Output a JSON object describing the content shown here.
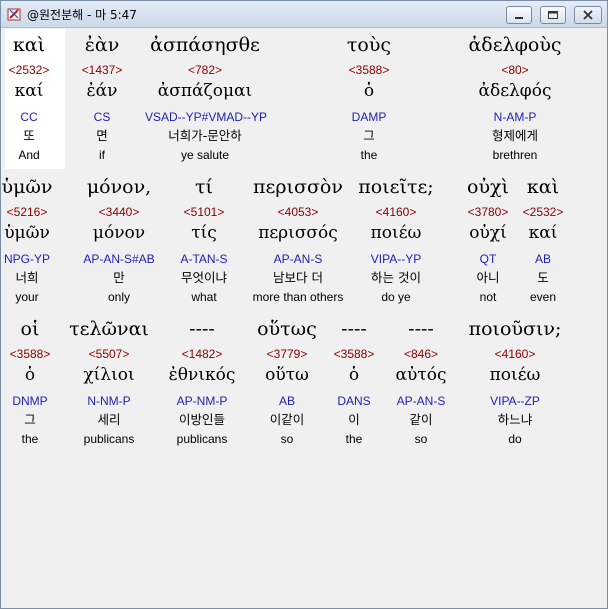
{
  "window": {
    "title": "@원전분해 - 마 5:47",
    "icon": "bible-app-icon",
    "controls": [
      "minimize",
      "maximize",
      "close"
    ]
  },
  "rows": [
    {
      "words": [
        {
          "greek": "καὶ",
          "strong": "<2532>",
          "lemma": "καί",
          "parse": "CC",
          "korean": "또",
          "english": "And"
        },
        {
          "greek": "ἐὰν",
          "strong": "<1437>",
          "lemma": "ἐάν",
          "parse": "CS",
          "korean": "면",
          "english": "if"
        },
        {
          "greek": "ἀσπάσησθε",
          "strong": "<782>",
          "lemma": "ἀσπάζομαι",
          "parse": "VSAD--YP#VMAD--YP",
          "korean": "너희가-문안하",
          "english": "ye salute"
        },
        {
          "greek": "τοὺς",
          "strong": "<3588>",
          "lemma": "ὁ",
          "parse": "DAMP",
          "korean": "그",
          "english": "the"
        },
        {
          "greek": "ἀδελφοὺς",
          "strong": "<80>",
          "lemma": "ἀδελφός",
          "parse": "N-AM-P",
          "korean": "형제에게",
          "english": "brethren"
        }
      ]
    },
    {
      "words": [
        {
          "greek": "ὑμῶν",
          "strong": "<5216>",
          "lemma": "ὑμῶν",
          "parse": "NPG-YP",
          "korean": "너희",
          "english": "your"
        },
        {
          "greek": "μόνον,",
          "strong": "<3440>",
          "lemma": "μόνον",
          "parse": "AP-AN-S#AB",
          "korean": "만",
          "english": "only"
        },
        {
          "greek": "τί",
          "strong": "<5101>",
          "lemma": "τίς",
          "parse": "A-TAN-S",
          "korean": "무엇이냐",
          "english": "what"
        },
        {
          "greek": "περισσὸν",
          "strong": "<4053>",
          "lemma": "περισσός",
          "parse": "AP-AN-S",
          "korean": "남보다 더",
          "english": "more than others"
        },
        {
          "greek": "ποιεῖτε;",
          "strong": "<4160>",
          "lemma": "ποιέω",
          "parse": "VIPA--YP",
          "korean": "하는 것이",
          "english": "do ye"
        },
        {
          "greek": "οὐχὶ",
          "strong": "<3780>",
          "lemma": "οὐχί",
          "parse": "QT",
          "korean": "아니",
          "english": "not"
        },
        {
          "greek": "καὶ",
          "strong": "<2532>",
          "lemma": "καί",
          "parse": "AB",
          "korean": "도",
          "english": "even"
        }
      ]
    },
    {
      "words": [
        {
          "greek": "οἱ",
          "strong": "<3588>",
          "lemma": "ὁ",
          "parse": "DNMP",
          "korean": "그",
          "english": "the"
        },
        {
          "greek": "τελῶναι",
          "strong": "<5507>",
          "lemma": "χίλιοι",
          "parse": "N-NM-P",
          "korean": "세리",
          "english": "publicans"
        },
        {
          "greek": "----",
          "strong": "<1482>",
          "lemma": "ἐθνικός",
          "parse": "AP-NM-P",
          "korean": "이방인들",
          "english": "publicans"
        },
        {
          "greek": "οὕτως",
          "strong": "<3779>",
          "lemma": "οὕτω",
          "parse": "AB",
          "korean": "이같이",
          "english": "so"
        },
        {
          "greek": "----",
          "strong": "<3588>",
          "lemma": "ὁ",
          "parse": "DANS",
          "korean": "이",
          "english": "the"
        },
        {
          "greek": "----",
          "strong": "<846>",
          "lemma": "αὐτός",
          "parse": "AP-AN-S",
          "korean": "같이",
          "english": "so"
        },
        {
          "greek": "ποιοῦσιν;",
          "strong": "<4160>",
          "lemma": "ποιέω",
          "parse": "VIPA--ZP",
          "korean": "하느냐",
          "english": "do"
        }
      ]
    }
  ],
  "colors": {
    "strong_number": "#8b0000",
    "parsing_code": "#1f1fb4",
    "text": "#000000",
    "selected_background": "#ffffff",
    "window_background": "#f0f0f0"
  }
}
